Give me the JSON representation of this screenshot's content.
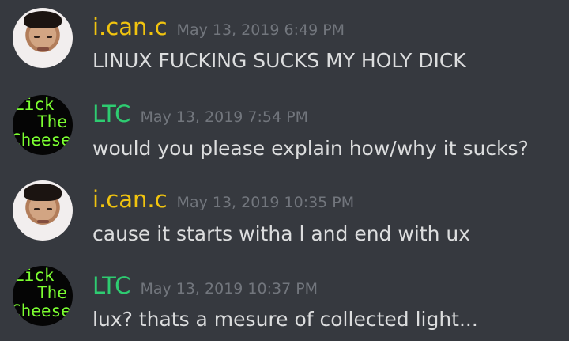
{
  "colors": {
    "background": "#36393f",
    "user_icanc": "#f1c40f",
    "user_ltc": "#2ecc71",
    "timestamp": "#72767d",
    "message_text": "#dcddde",
    "ltc_avatar_text": "#7cff31"
  },
  "ltc_avatar_lines": [
    "Lick",
    "The",
    "Cheese"
  ],
  "messages": [
    {
      "author": "i.can.c",
      "timestamp": "May 13, 2019 6:49 PM",
      "content": "LINUX FUCKING SUCKS MY HOLY DICK"
    },
    {
      "author": "LTC",
      "timestamp": "May 13, 2019 7:54 PM",
      "content": "would you please explain how/why it sucks?"
    },
    {
      "author": "i.can.c",
      "timestamp": "May 13, 2019 10:35 PM",
      "content": "cause it starts witha l and end with ux"
    },
    {
      "author": "LTC",
      "timestamp": "May 13, 2019 10:37 PM",
      "content": "lux? thats a mesure of collected light..."
    }
  ]
}
